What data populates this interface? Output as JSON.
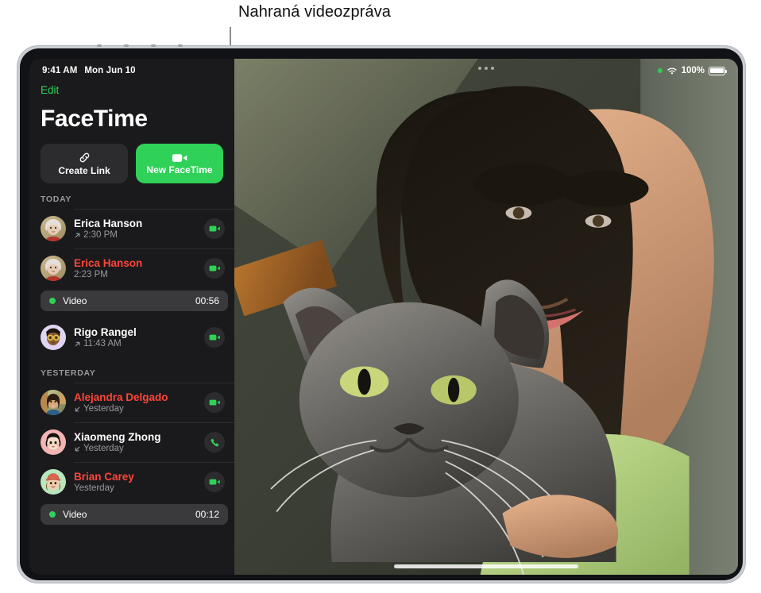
{
  "callout": {
    "text": "Nahraná videozpráva"
  },
  "statusbar": {
    "time": "9:41 AM",
    "date": "Mon Jun 10",
    "battery_percent": "100%",
    "focus_icon": "green-dot-icon",
    "wifi_icon": "wifi-icon",
    "battery_icon": "battery-full-icon"
  },
  "sidebar": {
    "edit_label": "Edit",
    "app_title": "FaceTime",
    "buttons": [
      {
        "label": "Create Link",
        "icon": "link-icon",
        "style": "dark"
      },
      {
        "label": "New FaceTime",
        "icon": "video-camera-icon",
        "style": "green"
      }
    ],
    "sections": [
      {
        "header": "TODAY",
        "rows": [
          {
            "name": "Erica Hanson",
            "missed": false,
            "direction_icon": "arrow-up-right-icon",
            "time": "2:30 PM",
            "action_icon": "video-camera-icon",
            "avatar": "photo-erica",
            "message": null
          },
          {
            "name": "Erica Hanson",
            "missed": true,
            "direction_icon": "",
            "time": "2:23 PM",
            "action_icon": "video-camera-icon",
            "avatar": "photo-erica",
            "message": {
              "label": "Video",
              "duration": "00:56",
              "dot": "green-dot-icon"
            }
          },
          {
            "name": "Rigo Rangel",
            "missed": false,
            "direction_icon": "arrow-up-right-icon",
            "time": "11:43 AM",
            "action_icon": "video-camera-icon",
            "avatar": "memoji-rigo",
            "message": null
          }
        ]
      },
      {
        "header": "YESTERDAY",
        "rows": [
          {
            "name": "Alejandra Delgado",
            "missed": true,
            "direction_icon": "arrow-down-left-icon",
            "time": "Yesterday",
            "action_icon": "video-camera-icon",
            "avatar": "photo-alejandra",
            "message": null
          },
          {
            "name": "Xiaomeng Zhong",
            "missed": false,
            "direction_icon": "arrow-down-left-icon",
            "time": "Yesterday",
            "action_icon": "phone-icon",
            "avatar": "memoji-xiaomeng",
            "message": null
          },
          {
            "name": "Brian Carey",
            "missed": true,
            "direction_icon": "",
            "time": "Yesterday",
            "action_icon": "video-camera-icon",
            "avatar": "memoji-brian",
            "message": {
              "label": "Video",
              "duration": "00:12",
              "dot": "green-dot-icon"
            }
          }
        ]
      }
    ]
  },
  "videopane": {
    "menu_icon": "more-dots-icon",
    "home_indicator": "home-indicator",
    "description": "Photo of a person holding a gray cat in sunlight"
  },
  "colors": {
    "accent_green": "#30d158",
    "missed_red": "#ff453a",
    "sidebar_bg": "#1a1a1c",
    "pill_bg": "#3a3a3c",
    "secondary_text": "#98989f"
  }
}
